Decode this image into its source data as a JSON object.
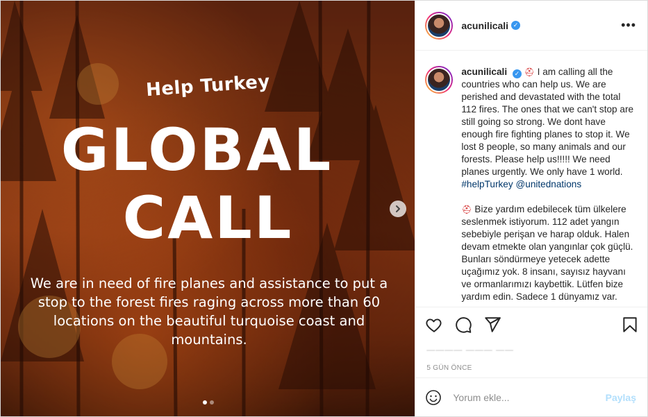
{
  "post": {
    "username": "acunilicali",
    "media": {
      "help_turkey": "Help Turkey",
      "global": "GLOBAL",
      "call": "CALL",
      "subtext": "We are in need of fire planes and assistance to put a stop to the forest fires raging across more than 60 locations on the beautiful turquoise coast and mountains.",
      "carousel_position": 1,
      "carousel_count": 2
    },
    "caption": {
      "username": "acunilicali",
      "en_text": "I am calling all the countries who can help us. We are perished and devastated with the total 112 fires. The ones that we can't stop are still going so strong. We dont have enough fire fighting planes to stop it. We lost 8 people, so many animals and our forests. Please help us!!!!! We need planes urgently. We only have 1 world.",
      "hashtag": "#helpTurkey",
      "mention": "@unitednations",
      "tr_text": "Bize yardım edebilecek tüm ülkelere seslenmek istiyorum. 112 adet yangın sebebiyle perişan ve harap olduk. Halen devam etmekte olan yangınlar çok güçlü. Bunları söndürmeye yetecek adette uçağımız yok. 8 insanı, sayısız hayvanı ve ormanlarımızı kaybettik. Lütfen bize yardım edin. Sadece 1 dünyamız var."
    },
    "time_ago": "5 GÜN ÖNCE",
    "comment_placeholder": "Yorum ekle...",
    "post_button": "Paylaş",
    "icons": {
      "like": "heart-icon",
      "comment": "comment-icon",
      "share": "share-icon",
      "save": "bookmark-icon",
      "more": "more-options-icon",
      "emoji": "emoji-icon",
      "next": "chevron-right-icon",
      "verified": "verified-badge-icon",
      "fire": "fire-helmet-emoji"
    },
    "colors": {
      "link": "#00376b",
      "verified": "#3897f0",
      "post_button_disabled": "#b2dffc"
    }
  }
}
